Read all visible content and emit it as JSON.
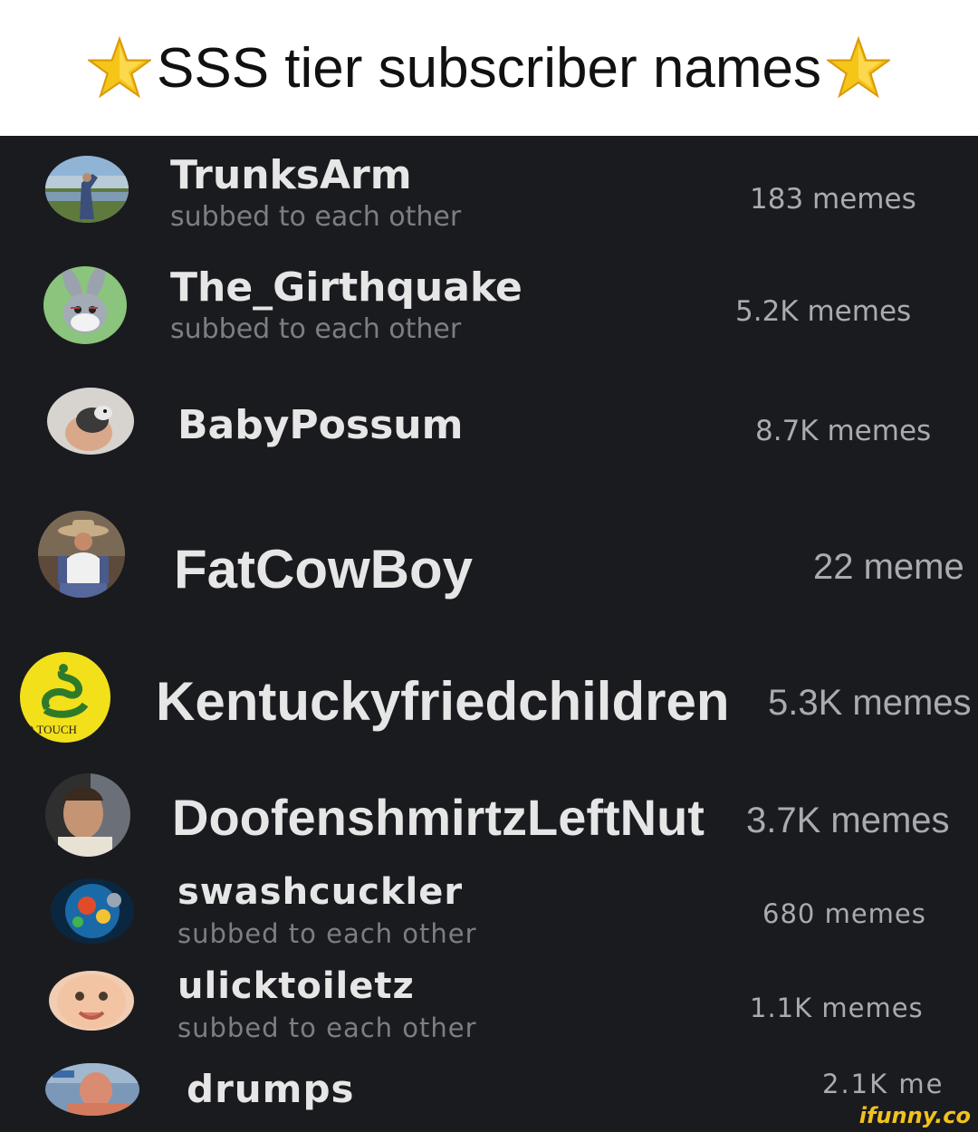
{
  "header": {
    "title": "SSS tier subscriber names",
    "left_icon": "star-icon",
    "right_icon": "star-icon",
    "star_color": "#f5c518"
  },
  "subscribers": [
    {
      "name": "TrunksArm",
      "status": "subbed to each other",
      "memes": "183 memes",
      "avatar": "avatar-photo-landscape"
    },
    {
      "name": "The_Girthquake",
      "status": "subbed to each other",
      "memes": "5.2K memes",
      "avatar": "avatar-bugs-bunny"
    },
    {
      "name": "BabyPossum",
      "status": "",
      "memes": "8.7K memes",
      "avatar": "avatar-possum"
    },
    {
      "name": "FatCowBoy",
      "status": "",
      "memes": "22 meme",
      "avatar": "avatar-cowboy"
    },
    {
      "name": "Kentuckyfriedchildren",
      "status": "",
      "memes": "5.3K memes",
      "avatar": "avatar-gadsden-flag",
      "avatar_text": "O TOUCH"
    },
    {
      "name": "DoofenshmirtzLeftNut",
      "status": "",
      "memes": "3.7K memes",
      "avatar": "avatar-man-portrait"
    },
    {
      "name": "swashcuckler",
      "status": "subbed to each other",
      "memes": "680 memes",
      "avatar": "avatar-colorful-art"
    },
    {
      "name": "ulicktoiletz",
      "status": "subbed to each other",
      "memes": "1.1K memes",
      "avatar": "avatar-baby-face"
    },
    {
      "name": "drumps",
      "status": "",
      "memes": "2.1K me",
      "avatar": "avatar-man-pointing"
    }
  ],
  "watermark": "ifunny.co"
}
